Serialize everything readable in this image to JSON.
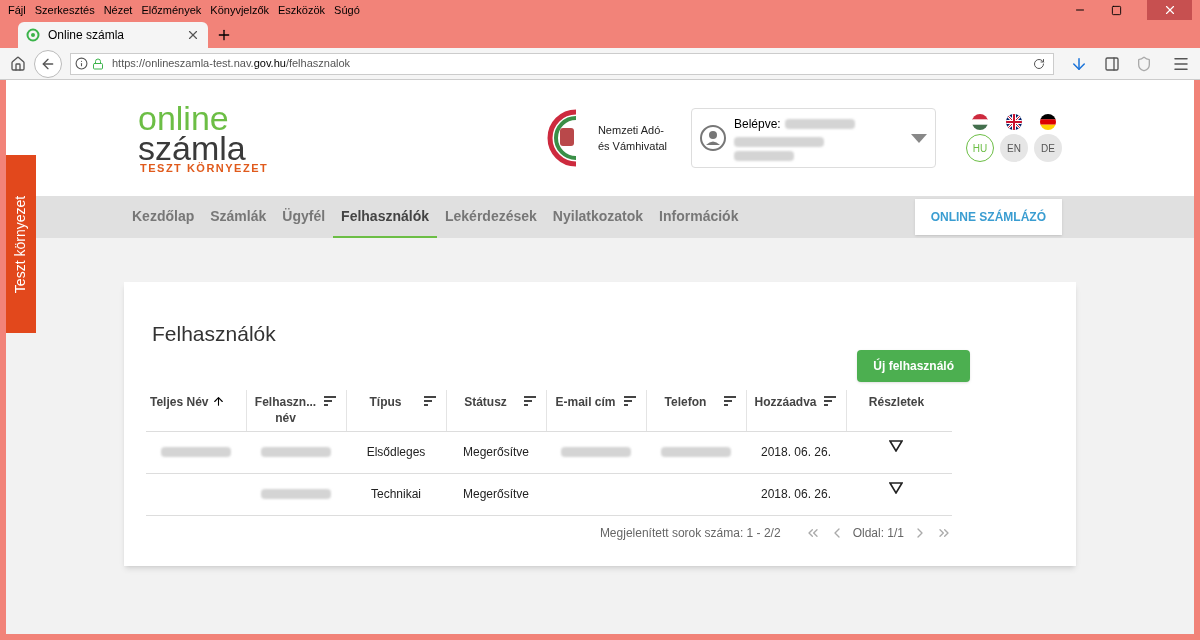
{
  "menu": [
    {
      "label": "Fájl"
    },
    {
      "label": "Szerkesztés"
    },
    {
      "label": "Nézet"
    },
    {
      "label": "Előzmények"
    },
    {
      "label": "Könyvjelzők"
    },
    {
      "label": "Eszközök"
    },
    {
      "label": "Súgó"
    }
  ],
  "tab": {
    "title": "Online számla",
    "selected": true
  },
  "url": {
    "prefix": "https://onlineszamla-test.nav.",
    "domain": "gov.hu",
    "path": "/felhasznalok"
  },
  "side_tab": "Teszt környezet",
  "logo": {
    "line1": "online",
    "line2": "számla",
    "sub": "TESZT KÖRNYEZET"
  },
  "agency": {
    "line1": "Nemzeti Adó-",
    "line2": "és Vámhivatal"
  },
  "user": {
    "label": "Belépve:"
  },
  "languages": [
    {
      "code": "HU",
      "selected": true,
      "kind": "hu"
    },
    {
      "code": "EN",
      "selected": false,
      "kind": "en"
    },
    {
      "code": "DE",
      "selected": false,
      "kind": "de"
    }
  ],
  "nav": [
    {
      "label": "Kezdőlap",
      "selected": false
    },
    {
      "label": "Számlák",
      "selected": false
    },
    {
      "label": "Ügyfél",
      "selected": false
    },
    {
      "label": "Felhasználók",
      "selected": true
    },
    {
      "label": "Lekérdezések",
      "selected": false
    },
    {
      "label": "Nyilatkozatok",
      "selected": false
    },
    {
      "label": "Információk",
      "selected": false
    }
  ],
  "nav_button": "ONLINE SZÁMLÁZÓ",
  "card": {
    "title": "Felhasználók",
    "new_button": "Új felhasználó"
  },
  "table": {
    "columns": [
      {
        "label": "Teljes Név",
        "kind": "sorted"
      },
      {
        "label": "Felhaszn... név",
        "kind": "sortable"
      },
      {
        "label": "Típus",
        "kind": "sortable"
      },
      {
        "label": "Státusz",
        "kind": "sortable"
      },
      {
        "label": "E-mail cím",
        "kind": "sortable"
      },
      {
        "label": "Telefon",
        "kind": "sortable"
      },
      {
        "label": "Hozzáadva",
        "kind": "sortable"
      },
      {
        "label": "Részletek",
        "kind": "plain"
      }
    ],
    "rows": [
      {
        "cells": [
          {
            "kind": "redacted"
          },
          {
            "kind": "redacted"
          },
          {
            "kind": "text",
            "text": "Elsődleges"
          },
          {
            "kind": "text",
            "text": "Megerősítve"
          },
          {
            "kind": "redacted"
          },
          {
            "kind": "redacted"
          },
          {
            "kind": "text",
            "text": "2018. 06. 26."
          },
          {
            "kind": "details"
          }
        ]
      },
      {
        "cells": [
          {
            "kind": "empty"
          },
          {
            "kind": "redacted"
          },
          {
            "kind": "text",
            "text": "Technikai"
          },
          {
            "kind": "text",
            "text": "Megerősítve"
          },
          {
            "kind": "empty"
          },
          {
            "kind": "empty"
          },
          {
            "kind": "text",
            "text": "2018. 06. 26."
          },
          {
            "kind": "details"
          }
        ]
      }
    ]
  },
  "footer": {
    "rows_label": "Megjelenített sorok száma: 1 - 2/2",
    "page_label": "Oldal: 1/1"
  }
}
